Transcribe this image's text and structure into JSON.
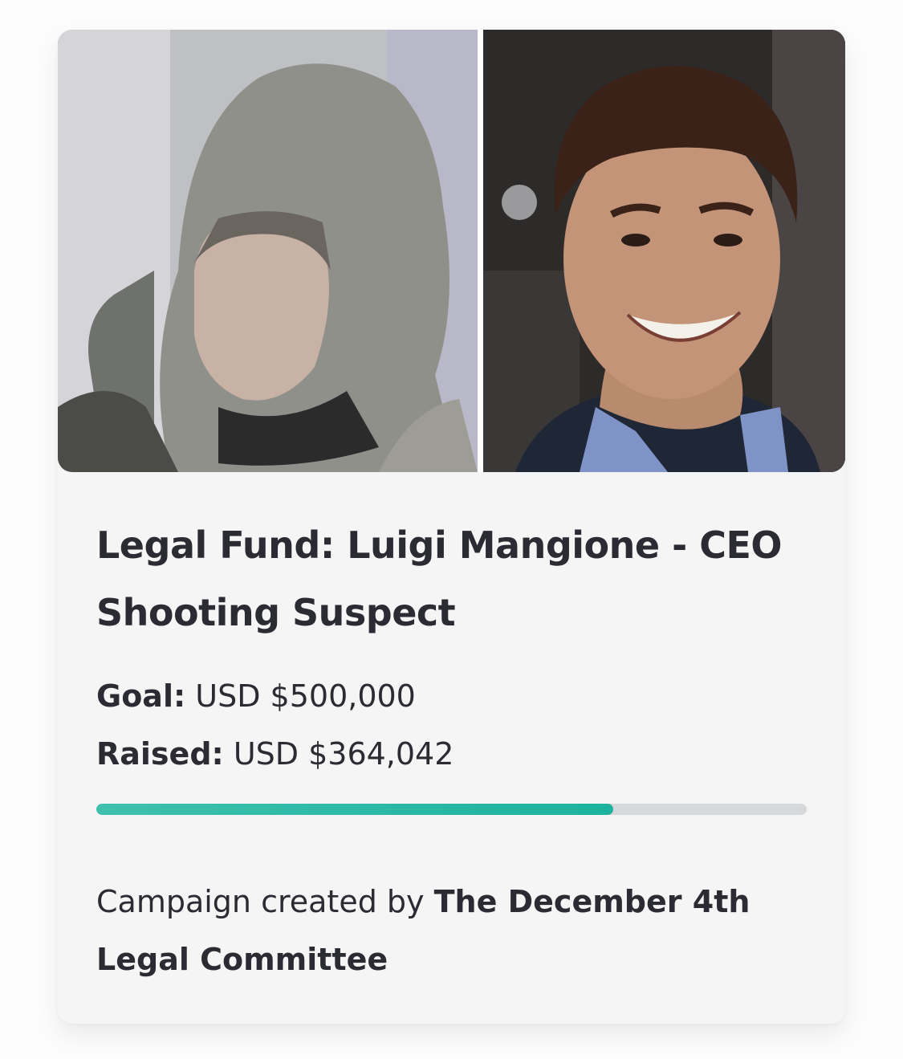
{
  "campaign": {
    "title": "Legal Fund: Luigi Mangione - CEO Shooting Suspect",
    "goal_label": "Goal:",
    "goal_value": "USD $500,000",
    "raised_label": "Raised:",
    "raised_value": "USD $364,042",
    "progress_fraction": 0.728,
    "creator_prefix": "Campaign created by",
    "creator_name": "The December 4th Legal Committee"
  },
  "colors": {
    "progress_fill": "#1bb39e",
    "progress_track": "#d6d8dc",
    "text": "#2b2b33",
    "card_background": "#f5f5f5"
  }
}
